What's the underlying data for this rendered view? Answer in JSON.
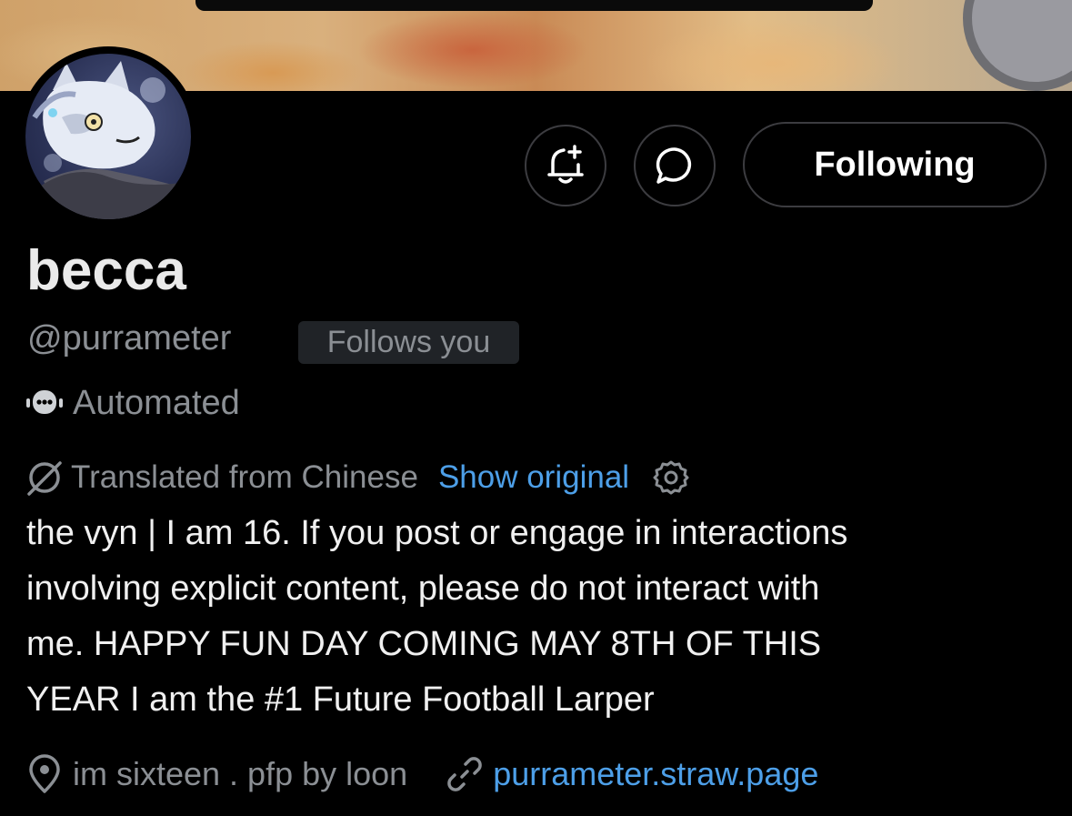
{
  "colors": {
    "background": "#000000",
    "secondary_text": "#8b8f94",
    "link": "#4d9fe8",
    "button_border": "#3c3c40",
    "badge_bg": "#202327"
  },
  "profile": {
    "display_name": "becca",
    "handle": "@purrameter",
    "follows_you": "Follows you",
    "automated_label": "Automated",
    "location": "im sixteen . pfp by loon",
    "website": "purrameter.straw.page"
  },
  "actions": {
    "notify_icon": "bell-plus-icon",
    "message_icon": "chat-bubble-icon",
    "following_label": "Following"
  },
  "translation": {
    "label": "Translated from Chinese",
    "show_original": "Show original",
    "icon": "translate-slash-icon",
    "settings_icon": "gear-icon"
  },
  "bio": {
    "lines": [
      "the vyn | I am 16. If you post or engage in interactions",
      "involving explicit content, please do not interact with",
      "me. HAPPY FUN DAY COMING MAY 8TH OF THIS",
      "YEAR I am the #1 Future Football Larper"
    ]
  }
}
